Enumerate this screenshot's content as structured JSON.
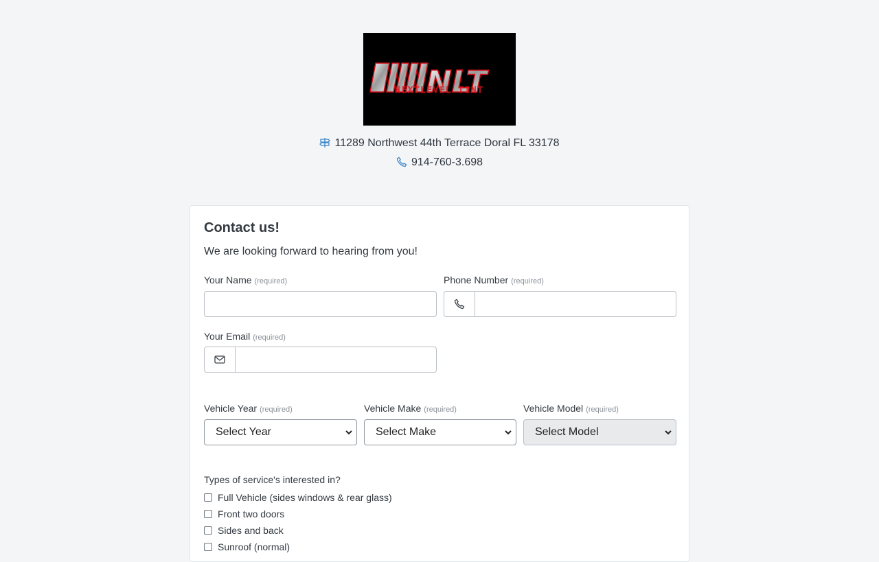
{
  "brand": {
    "logo_mark": "NLT",
    "logo_text": "NEXTLEVEL TINT"
  },
  "contact_info": {
    "address_icon": "signpost-icon",
    "address": "11289 Northwest 44th Terrace Doral FL 33178",
    "phone_icon": "phone-icon",
    "phone": "914-760-3.698"
  },
  "form": {
    "title": "Contact us!",
    "subtitle": "We are looking forward to hearing from you!",
    "required_tag": "(required)",
    "name": {
      "label": "Your Name",
      "value": "",
      "placeholder": ""
    },
    "phone": {
      "label": "Phone Number",
      "icon": "phone-icon",
      "value": "",
      "placeholder": ""
    },
    "email": {
      "label": "Your Email",
      "icon": "envelope-icon",
      "value": "",
      "placeholder": ""
    },
    "vehicle_year": {
      "label": "Vehicle Year",
      "selected": "Select Year"
    },
    "vehicle_make": {
      "label": "Vehicle Make",
      "selected": "Select Make"
    },
    "vehicle_model": {
      "label": "Vehicle Model",
      "selected": "Select Model",
      "disabled": true
    },
    "services": {
      "label": "Types of service's interested in?",
      "options": [
        {
          "label": "Full Vehicle (sides windows & rear glass)",
          "checked": false
        },
        {
          "label": "Front two doors",
          "checked": false
        },
        {
          "label": "Sides and back",
          "checked": false
        },
        {
          "label": "Sunroof (normal)",
          "checked": false
        }
      ]
    }
  },
  "colors": {
    "page_bg": "#f4f5f7",
    "icon_blue": "#3a86c8",
    "logo_red": "#e0141e"
  }
}
